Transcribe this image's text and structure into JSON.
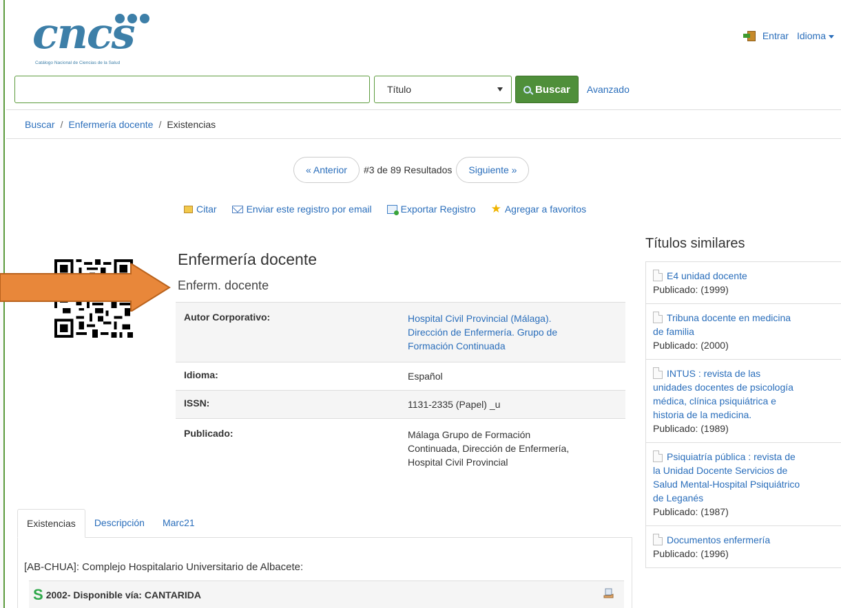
{
  "header": {
    "logo_text": "cnc",
    "logo_accent": "s",
    "logo_subtitle": "Catálogo Nacional de Ciencias de la Salud",
    "login_label": "Entrar",
    "language_label": "Idioma"
  },
  "search": {
    "query": "",
    "field_selected": "Título",
    "button_label": "Buscar",
    "advanced_label": "Avanzado"
  },
  "breadcrumb": {
    "items": [
      "Buscar",
      "Enfermería docente",
      "Existencias"
    ]
  },
  "pager": {
    "prev_label": "« Anterior",
    "status": "#3 de 89 Resultados",
    "next_label": "Siguiente »"
  },
  "tools": {
    "cite": "Citar",
    "email": "Enviar este registro por email",
    "export": "Exportar Registro",
    "favorite": "Agregar a favoritos"
  },
  "record": {
    "title": "Enfermería docente",
    "subtitle": "Enferm. docente",
    "fields": [
      {
        "label": "Autor Corporativo:",
        "lines": [
          "Hospital Civil Provincial (Málaga).",
          "Dirección de Enfermería. Grupo de",
          "Formación Continuada"
        ]
      },
      {
        "label": "Idioma:",
        "value": "Español"
      },
      {
        "label": "ISSN:",
        "value": "1131-2335 (Papel) _u"
      },
      {
        "label": "Publicado:",
        "lines": [
          "Málaga Grupo de Formación",
          "Continuada, Dirección de Enfermería,",
          "Hospital Civil Provincial"
        ]
      }
    ]
  },
  "tabs": {
    "items": [
      "Existencias",
      "Descripción",
      "Marc21"
    ],
    "active": "Existencias"
  },
  "holdings": {
    "library": "[AB-CHUA]: Complejo Hospitalario Universitario de Albacete:",
    "item": "2002- Disponible vía: CANTARIDA"
  },
  "similar": {
    "heading": "Títulos similares",
    "items": [
      {
        "lines": [
          "E4 unidad docente"
        ],
        "published": "Publicado: (1999)"
      },
      {
        "lines": [
          "Tribuna docente en medicina",
          "de familia"
        ],
        "published": "Publicado: (2000)"
      },
      {
        "lines": [
          "INTUS : revista de las",
          "unidades docentes de psicología",
          "médica, clínica psiquiátrica e",
          "historia de la medicina."
        ],
        "published": "Publicado: (1989)"
      },
      {
        "lines": [
          "Psiquiatría pública : revista de",
          "la Unidad Docente Servicios de",
          "Salud Mental-Hospital Psiquiátrico",
          "de Leganés"
        ],
        "published": "Publicado: (1987)"
      },
      {
        "lines": [
          "Documentos enfermería"
        ],
        "published": "Publicado: (1996)"
      }
    ]
  },
  "colors": {
    "brand_blue": "#3d7fa8",
    "link": "#2a6ebb",
    "search_button": "#4f8f3a",
    "arrow": "#e8873a"
  },
  "icons": [
    "login-door-icon",
    "search-magnifier-icon",
    "cite-icon",
    "email-icon",
    "export-icon",
    "star-icon",
    "qr-code",
    "document-icon",
    "hand-request-icon"
  ]
}
